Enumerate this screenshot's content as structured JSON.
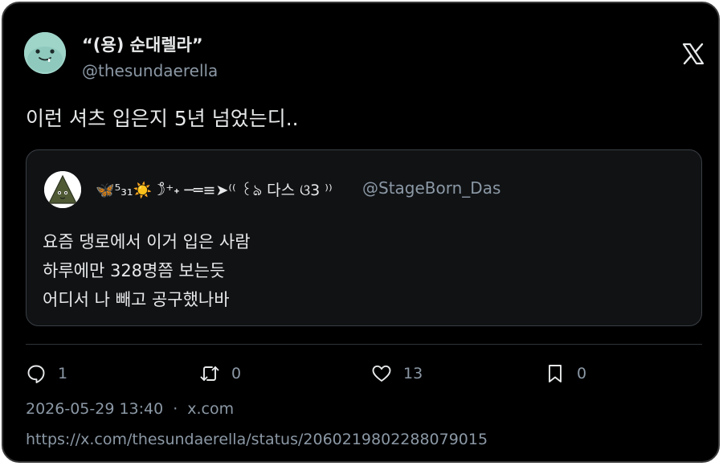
{
  "author": {
    "display_name": "“(용) 순대렐라”",
    "handle": "@thesundaerella"
  },
  "tweet": {
    "text": "이런 셔츠 입은지 5년 넘었는디.."
  },
  "quoted": {
    "display_name": "🦋⁵₃₁☀️☽̊⁺˖ ─═≡➤⁽⁽ ꒰ঌ 다스 ଓ3 ⁾⁾",
    "handle": "@StageBorn_Das",
    "lines": [
      "요즘 댕로에서 이거 입은 사람",
      "하루에만 328명쯤 보는듯",
      "어디서 나 빼고 공구했나바"
    ]
  },
  "actions": {
    "reply_count": "1",
    "retweet_count": "0",
    "like_count": "13",
    "bookmark_count": "0"
  },
  "meta": {
    "timestamp": "2026-05-29 13:40",
    "separator": "·",
    "source": "x.com",
    "url": "https://x.com/thesundaerella/status/2060219802288079015"
  },
  "icons": {
    "brand": "x-logo-icon",
    "reply": "reply-icon",
    "retweet": "retweet-icon",
    "like": "heart-icon",
    "bookmark": "bookmark-icon"
  },
  "colors": {
    "background": "#000000",
    "border": "#3a3a3a",
    "text": "#e7e9ea",
    "muted": "#8b98a5",
    "avatar": "#9fd4c9"
  }
}
